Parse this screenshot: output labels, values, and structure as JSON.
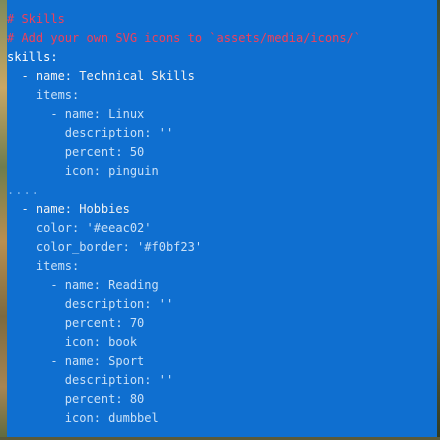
{
  "editor": {
    "lines": [
      {
        "text": "# Skills",
        "kind": "comment"
      },
      {
        "text": "# Add your own SVG icons to `assets/media/icons/`",
        "kind": "comment"
      },
      {
        "text": "skills:",
        "kind": "key"
      },
      {
        "text": "  - name: Technical Skills",
        "kind": "key"
      },
      {
        "text": "    items:",
        "kind": "key3"
      },
      {
        "text": "      - name: Linux",
        "kind": "key3"
      },
      {
        "text": "        description: ''",
        "kind": "key3"
      },
      {
        "text": "        percent: 50",
        "kind": "key3"
      },
      {
        "text": "        icon: pinguin",
        "kind": "key3"
      },
      {
        "text": "....",
        "kind": "dim"
      },
      {
        "text": "  - name: Hobbies",
        "kind": "key"
      },
      {
        "text": "    color: '#eeac02'",
        "kind": "key3"
      },
      {
        "text": "    color_border: '#f0bf23'",
        "kind": "key3"
      },
      {
        "text": "    items:",
        "kind": "key3"
      },
      {
        "text": "      - name: Reading",
        "kind": "key3"
      },
      {
        "text": "        description: ''",
        "kind": "key3"
      },
      {
        "text": "        percent: 70",
        "kind": "key3"
      },
      {
        "text": "        icon: book",
        "kind": "key3"
      },
      {
        "text": "      - name: Sport",
        "kind": "key3"
      },
      {
        "text": "        description: ''",
        "kind": "key3"
      },
      {
        "text": "        percent: 80",
        "kind": "key3"
      },
      {
        "text": "        icon: dumbbel",
        "kind": "key3"
      }
    ]
  },
  "colors": {
    "background": "#0f6fd0",
    "comment": "#f0405a",
    "key": "#ffffff",
    "nested": "#c9e0f7"
  }
}
